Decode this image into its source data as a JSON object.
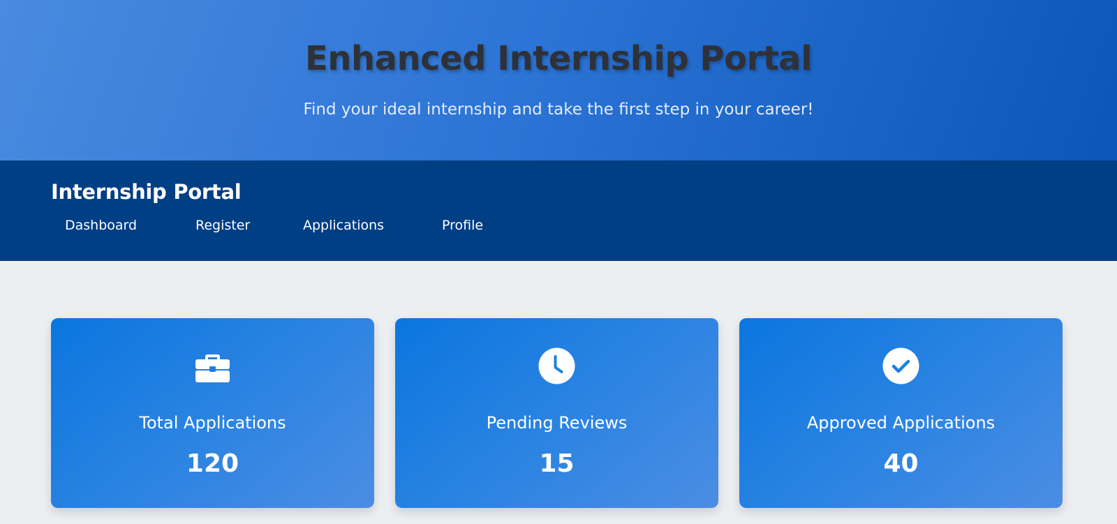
{
  "hero": {
    "title": "Enhanced Internship Portal",
    "subtitle": "Find your ideal internship and take the first step in your career!"
  },
  "navbar": {
    "brand": "Internship Portal",
    "items": [
      {
        "label": "Dashboard"
      },
      {
        "label": "Register"
      },
      {
        "label": "Applications"
      },
      {
        "label": "Profile"
      }
    ]
  },
  "stats": [
    {
      "icon": "briefcase-icon",
      "label": "Total Applications",
      "value": "120"
    },
    {
      "icon": "clock-icon",
      "label": "Pending Reviews",
      "value": "15"
    },
    {
      "icon": "check-circle-icon",
      "label": "Approved Applications",
      "value": "40"
    }
  ],
  "colors": {
    "hero_start": "#4a8ae0",
    "hero_end": "#0a56b9",
    "navbar": "#013f84",
    "card": "#1f80e0",
    "background": "#eceff2",
    "title": "#2e3138"
  }
}
